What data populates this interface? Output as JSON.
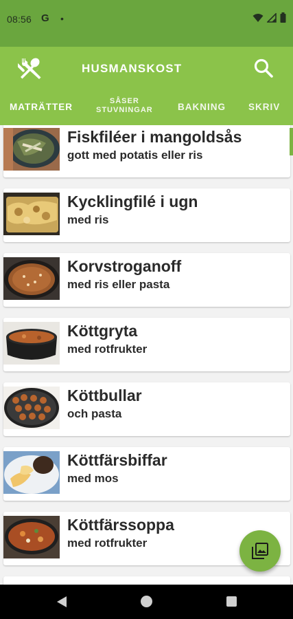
{
  "status_bar": {
    "time": "08:56",
    "google_icon": "G",
    "dot": "•",
    "icons": [
      "wifi-icon",
      "signal-icon",
      "battery-icon"
    ]
  },
  "app_bar": {
    "title": "HUSMANSKOST",
    "logo_icon": "fork-spoon-icon",
    "search_icon": "search-icon"
  },
  "tabs": [
    {
      "label": "MATRÄTTER",
      "selected": true
    },
    {
      "label_line1": "SÅSER",
      "label_line2": "STUVNINGAR",
      "selected": false
    },
    {
      "label": "BAKNING",
      "selected": false
    },
    {
      "label": "SKRIV",
      "selected": false
    }
  ],
  "recipes": [
    {
      "title": "Fiskfiléer i mangoldsås",
      "subtitle": "gott med potatis eller ris"
    },
    {
      "title": "Kycklingfilé i ugn",
      "subtitle": "med ris"
    },
    {
      "title": "Korvstroganoff",
      "subtitle": "med ris eller pasta"
    },
    {
      "title": "Köttgryta",
      "subtitle": "med rotfrukter"
    },
    {
      "title": "Köttbullar",
      "subtitle": "och pasta"
    },
    {
      "title": "Köttfärsbiffar",
      "subtitle": "med mos"
    },
    {
      "title": "Köttfärssoppa",
      "subtitle": "med rotfrukter"
    }
  ],
  "fab_icon": "gallery-icon",
  "nav_bar": {
    "icons": [
      "back-icon",
      "home-icon",
      "recents-icon"
    ]
  },
  "colors": {
    "status_bar": "#6aa63e",
    "app_bar": "#8bc34a",
    "accent": "#7cb342",
    "card_background": "#ffffff",
    "text": "#2a2a2a"
  }
}
